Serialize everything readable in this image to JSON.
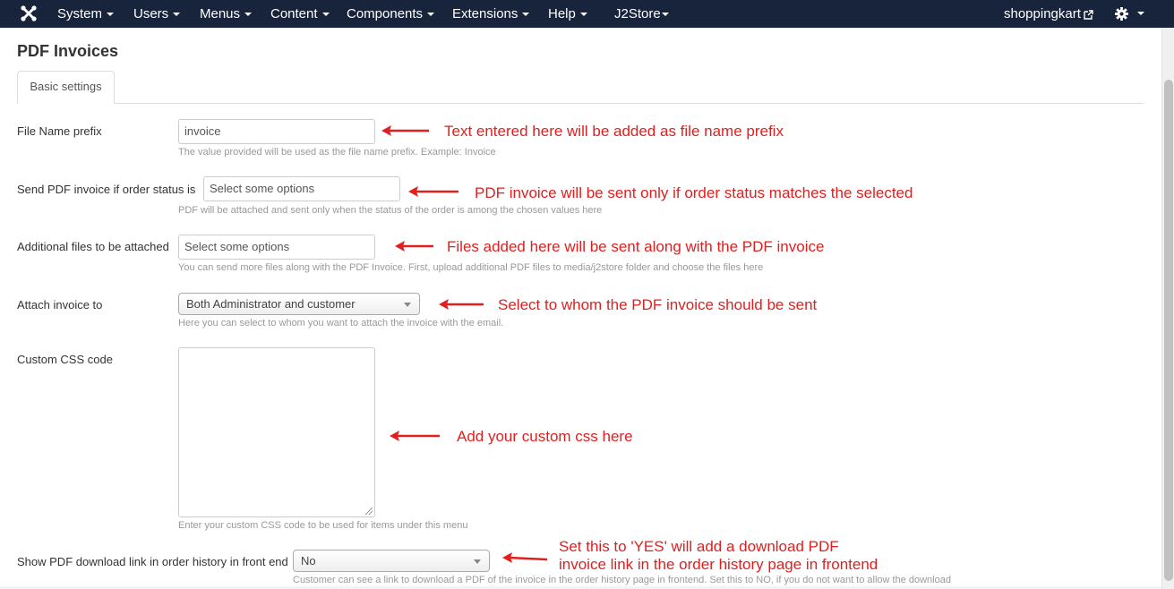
{
  "navbar": {
    "logo": "joomla-logo",
    "menus": [
      "System",
      "Users",
      "Menus",
      "Content",
      "Components",
      "Extensions",
      "Help",
      "J2Store"
    ],
    "site_link": "shoppingkart",
    "settings_icon": "gear-icon"
  },
  "page": {
    "title": "PDF Invoices",
    "tab": "Basic settings"
  },
  "form": {
    "file_prefix": {
      "label": "File Name prefix",
      "value": "invoice",
      "help": "The value provided will be used as the file name prefix. Example: Invoice"
    },
    "order_status": {
      "label": "Send PDF invoice if order status is",
      "placeholder": "Select some options",
      "help": "PDF will be attached and sent only when the status of the order is among the chosen values here"
    },
    "additional_files": {
      "label": "Additional files to be attached",
      "placeholder": "Select some options",
      "help": "You can send more files along with the PDF Invoice. First, upload additional PDF files to media/j2store folder and choose the files here"
    },
    "attach_to": {
      "label": "Attach invoice to",
      "value": "Both Administrator and customer",
      "help": "Here you can select to whom you want to attach the invoice with the email."
    },
    "custom_css": {
      "label": "Custom CSS code",
      "value": "",
      "help": "Enter your custom CSS code to be used for items under this menu"
    },
    "download_link": {
      "label": "Show PDF download link in order history in front end",
      "value": "No",
      "help": "Customer can see a link to download a PDF of the invoice in the order history page in frontend. Set this to NO, if you do not want to allow the download"
    }
  },
  "annotations": {
    "file_prefix": "Text entered here will be added as file name prefix",
    "order_status": "PDF invoice will be sent only if order status matches the selected",
    "additional_files": "Files added here will be sent along with the PDF invoice",
    "attach_to": "Select to whom the PDF invoice should be sent",
    "custom_css": "Add your custom css here",
    "download_link_1": "Set this to 'YES' will add a download PDF",
    "download_link_2": "invoice link in the order history page in frontend",
    "color": "#e02020"
  }
}
